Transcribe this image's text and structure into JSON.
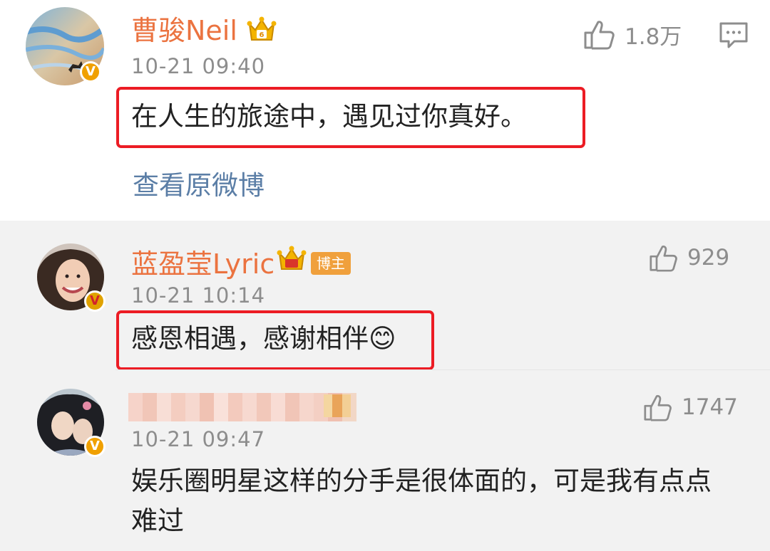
{
  "comments": [
    {
      "username": "曹骏Neil",
      "time": "10-21 09:40",
      "content": "在人生的旅途中，遇见过你真好。",
      "likes": "1.8万",
      "view_original": "查看原微博"
    },
    {
      "username": "蓝盈莹Lyric",
      "role_badge": "博主",
      "time": "10-21 10:14",
      "content": "感恩相遇，感谢相伴😊",
      "likes": "929"
    },
    {
      "username": "",
      "time": "10-21 09:47",
      "content": "娱乐圈明星这样的分手是很体面的，可是我有点点难过",
      "likes": "1747"
    }
  ],
  "colors": {
    "username": "#eb7340",
    "highlight_border": "#ec1c24",
    "link": "#5b7ea6",
    "verified_badge": "#f0a000"
  },
  "icons": [
    "thumbs-up-icon",
    "reply-comment-icon",
    "crown-vip-icon",
    "verified-v-icon"
  ]
}
